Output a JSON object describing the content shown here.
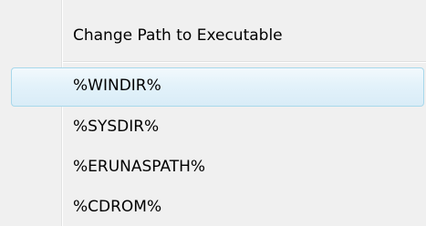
{
  "menu": {
    "header_label": "Change Path to Executable",
    "items": [
      {
        "label": "%WINDIR%",
        "highlighted": true
      },
      {
        "label": "%SYSDIR%",
        "highlighted": false
      },
      {
        "label": "%ERUNASPATH%",
        "highlighted": false
      },
      {
        "label": "%CDROM%",
        "highlighted": false
      }
    ]
  },
  "colors": {
    "menu_background": "#f0f0f0",
    "highlight_border": "#a8d8eb",
    "highlight_fill": "#e3f2fa"
  }
}
